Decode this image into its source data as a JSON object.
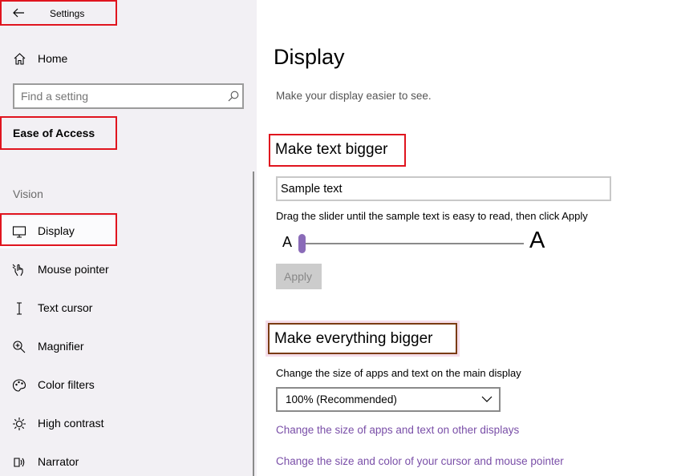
{
  "app": {
    "title": "Settings"
  },
  "sidebar": {
    "home_label": "Home",
    "search": {
      "placeholder": "Find a setting",
      "value": ""
    },
    "section_title": "Ease of Access",
    "group_label": "Vision",
    "items": [
      {
        "label": "Display",
        "icon": "monitor-icon",
        "selected": true
      },
      {
        "label": "Mouse pointer",
        "icon": "mouse-pointer-icon"
      },
      {
        "label": "Text cursor",
        "icon": "text-cursor-icon"
      },
      {
        "label": "Magnifier",
        "icon": "magnifier-icon"
      },
      {
        "label": "Color filters",
        "icon": "color-filters-icon"
      },
      {
        "label": "High contrast",
        "icon": "high-contrast-icon"
      },
      {
        "label": "Narrator",
        "icon": "narrator-icon"
      }
    ]
  },
  "main": {
    "title": "Display",
    "subtitle": "Make your display easier to see.",
    "text_bigger": {
      "heading": "Make text bigger",
      "sample_text": "Sample text",
      "instruction": "Drag the slider until the sample text is easy to read, then click Apply",
      "small_a": "A",
      "large_a": "A",
      "slider_value_percent": 0,
      "apply_label": "Apply"
    },
    "everything_bigger": {
      "heading": "Make everything bigger",
      "scale_label": "Change the size of apps and text on the main display",
      "scale_value": "100% (Recommended)",
      "link_other_displays": "Change the size of apps and text on other displays",
      "link_cursor": "Change the size and color of your cursor and mouse pointer"
    }
  },
  "colors": {
    "accent": "#7a4fa8",
    "highlight_red": "#e0141e",
    "highlight_brown": "#7a3b12",
    "slider_thumb": "#8a6bb8"
  }
}
